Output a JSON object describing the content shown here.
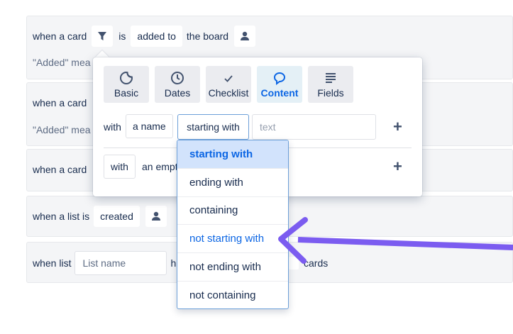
{
  "colors": {
    "accent": "#0c66e4",
    "arrow": "#7b5cf0",
    "panel": "#f4f5f7"
  },
  "rules": [
    {
      "prefix": "when a card",
      "is": "is",
      "value": "added to",
      "suffix": "the board",
      "note": "\"Added\" mea"
    },
    {
      "prefix": "when a card",
      "note": "\"Added\" mea"
    },
    {
      "prefix": "when a card"
    },
    {
      "prefix": "when a list is",
      "value": "created"
    },
    {
      "prefix": "when list",
      "placeholder": "List name",
      "partial": "h",
      "suffix": "cards"
    }
  ],
  "popover": {
    "tabs": [
      {
        "label": "Basic",
        "icon": "sticker-icon"
      },
      {
        "label": "Dates",
        "icon": "clock-icon"
      },
      {
        "label": "Checklist",
        "icon": "check-icon"
      },
      {
        "label": "Content",
        "icon": "speech-bubble-icon",
        "active": true
      },
      {
        "label": "Fields",
        "icon": "lines-icon"
      }
    ],
    "row1": {
      "with": "with",
      "field": "a name",
      "operator": "starting with",
      "text_placeholder": "text"
    },
    "row2": {
      "with": "with",
      "partial": "an empt"
    }
  },
  "dropdown": {
    "options": [
      "starting with",
      "ending with",
      "containing",
      "not starting with",
      "not ending with",
      "not containing"
    ],
    "selected": "starting with",
    "highlighted": "not starting with"
  }
}
